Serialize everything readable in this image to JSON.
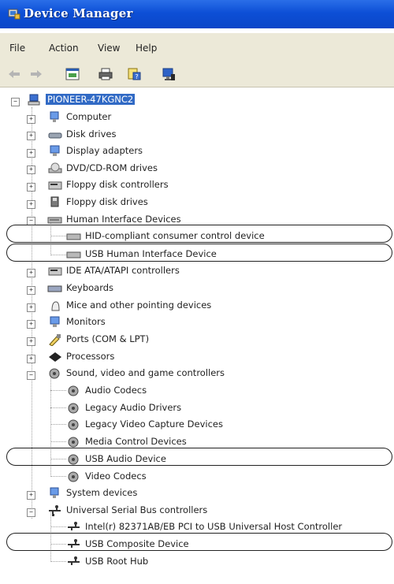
{
  "window": {
    "title": "Device Manager"
  },
  "menu": [
    "File",
    "Action",
    "View",
    "Help"
  ],
  "toolbar": [
    "back-icon",
    "forward-icon",
    "properties-icon",
    "print-icon",
    "help-icon",
    "monitor-icon"
  ],
  "tree": {
    "root": "PIONEER-47KGNC2",
    "categories": [
      {
        "label": "Computer",
        "icon": "computer-icon",
        "expanded": false
      },
      {
        "label": "Disk drives",
        "icon": "disk-drive-icon",
        "expanded": false
      },
      {
        "label": "Display adapters",
        "icon": "monitor-icon",
        "expanded": false
      },
      {
        "label": "DVD/CD-ROM drives",
        "icon": "cd-drive-icon",
        "expanded": false
      },
      {
        "label": "Floppy disk controllers",
        "icon": "controller-icon",
        "expanded": false
      },
      {
        "label": "Floppy disk drives",
        "icon": "floppy-icon",
        "expanded": false
      },
      {
        "label": "Human Interface Devices",
        "icon": "hid-icon",
        "expanded": true,
        "children": [
          "HID-compliant consumer control device",
          "USB Human Interface Device"
        ]
      },
      {
        "label": "IDE ATA/ATAPI controllers",
        "icon": "controller-icon",
        "expanded": false
      },
      {
        "label": "Keyboards",
        "icon": "keyboard-icon",
        "expanded": false
      },
      {
        "label": "Mice and other pointing devices",
        "icon": "mouse-icon",
        "expanded": false
      },
      {
        "label": "Monitors",
        "icon": "monitor-icon",
        "expanded": false
      },
      {
        "label": "Ports (COM & LPT)",
        "icon": "port-icon",
        "expanded": false
      },
      {
        "label": "Processors",
        "icon": "processor-icon",
        "expanded": false
      },
      {
        "label": "Sound, video and game controllers",
        "icon": "sound-icon",
        "expanded": true,
        "children": [
          "Audio Codecs",
          "Legacy Audio Drivers",
          "Legacy Video Capture Devices",
          "Media Control Devices",
          "USB Audio Device",
          "Video Codecs"
        ]
      },
      {
        "label": "System devices",
        "icon": "computer-icon",
        "expanded": false
      },
      {
        "label": "Universal Serial Bus controllers",
        "icon": "usb-icon",
        "expanded": true,
        "children": [
          "Intel(r) 82371AB/EB PCI to USB Universal Host Controller",
          "USB Composite Device",
          "USB Root Hub"
        ]
      }
    ]
  },
  "highlighted": [
    "HID-compliant consumer control device",
    "USB Human Interface Device",
    "USB Audio Device",
    "USB Composite Device"
  ]
}
